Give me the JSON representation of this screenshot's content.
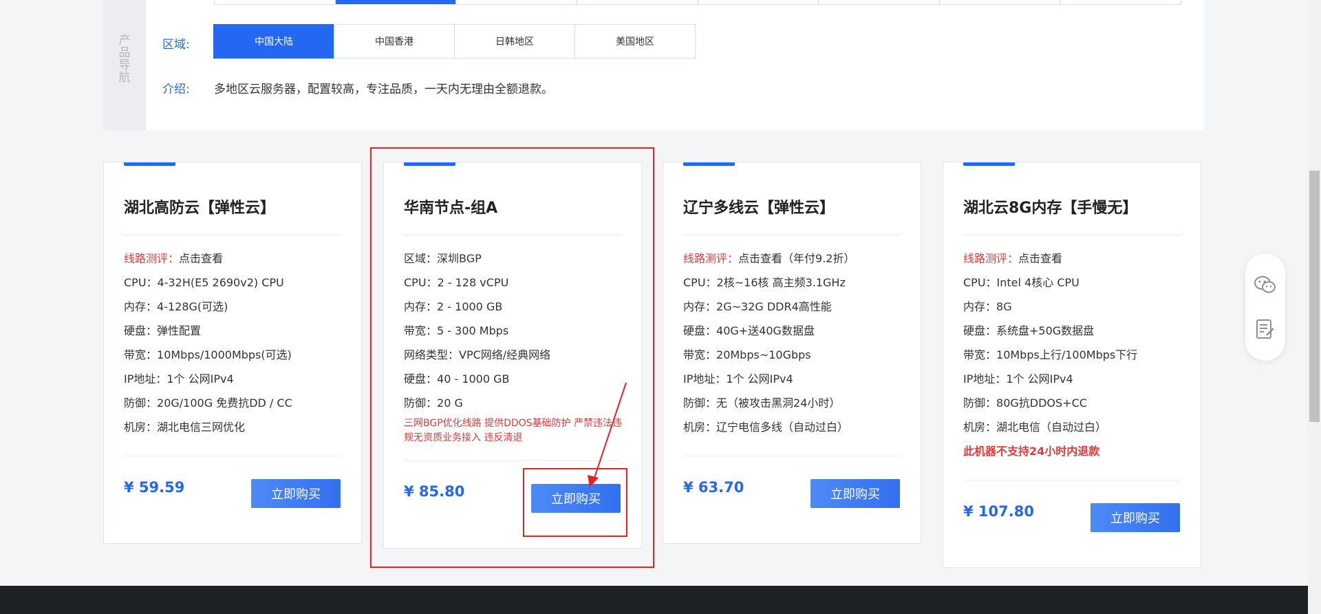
{
  "nav": {
    "side_label": "产品导航",
    "region_label": "区域:",
    "intro_label": "介绍:",
    "regions": [
      {
        "label": "中国大陆",
        "active": true
      },
      {
        "label": "中国香港",
        "active": false
      },
      {
        "label": "日韩地区",
        "active": false
      },
      {
        "label": "美国地区",
        "active": false
      }
    ],
    "intro_text": "多地区云服务器，配置较高，专注品质，一天内无理由全额退款。"
  },
  "cards": [
    {
      "title": "湖北高防云【弹性云】",
      "specs": [
        {
          "k": "线路测评：",
          "v": "点击查看",
          "red_key": true
        },
        {
          "k": "CPU：",
          "v": "4-32H(E5 2690v2) CPU"
        },
        {
          "k": "内存：",
          "v": "4-128G(可选)"
        },
        {
          "k": "硬盘：",
          "v": "弹性配置"
        },
        {
          "k": "带宽：",
          "v": "10Mbps/1000Mbps(可选)"
        },
        {
          "k": "IP地址：",
          "v": "1个 公网IPv4"
        },
        {
          "k": "防御：",
          "v": "20G/100G 免费抗DD / CC"
        },
        {
          "k": "机房：",
          "v": "湖北电信三网优化"
        }
      ],
      "price": "¥ 59.59",
      "buy_label": "立即购买"
    },
    {
      "title": "华南节点-组A",
      "specs": [
        {
          "k": "区域：",
          "v": "深圳BGP"
        },
        {
          "k": "CPU：",
          "v": "2 - 128 vCPU"
        },
        {
          "k": "内存：",
          "v": "2 - 1000 GB"
        },
        {
          "k": "带宽：",
          "v": "5 - 300 Mbps"
        },
        {
          "k": "网络类型：",
          "v": "VPC网络/经典网络"
        },
        {
          "k": "硬盘：",
          "v": "40 - 1000 GB"
        },
        {
          "k": "防御：",
          "v": "20 G"
        }
      ],
      "note": "三网BGP优化线路 提供DDOS基础防护 严禁违法违规无资质业务接入 违反清退",
      "price": "¥ 85.80",
      "buy_label": "立即购买"
    },
    {
      "title": "辽宁多线云【弹性云】",
      "specs": [
        {
          "k": "线路测评：",
          "v": "点击查看（年付9.2折）",
          "red_key": true
        },
        {
          "k": "CPU：",
          "v": "2核~16核 高主频3.1GHz"
        },
        {
          "k": "内存：",
          "v": "2G~32G DDR4高性能"
        },
        {
          "k": "硬盘：",
          "v": "40G+送40G数据盘"
        },
        {
          "k": "带宽：",
          "v": "20Mbps~10Gbps"
        },
        {
          "k": "IP地址：",
          "v": "1个 公网IPv4"
        },
        {
          "k": "防御：",
          "v": "无（被攻击黑洞24小时）"
        },
        {
          "k": "机房：",
          "v": "辽宁电信多线（自动过白）"
        }
      ],
      "price": "¥ 63.70",
      "buy_label": "立即购买"
    },
    {
      "title": "湖北云8G内存【手慢无】",
      "specs": [
        {
          "k": "线路测评：",
          "v": "点击查看",
          "red_key": true
        },
        {
          "k": "CPU：",
          "v": "Intel 4核心 CPU"
        },
        {
          "k": "内存：",
          "v": "8G"
        },
        {
          "k": "硬盘：",
          "v": "系统盘+50G数据盘"
        },
        {
          "k": "带宽：",
          "v": "10Mbps上行/100Mbps下行"
        },
        {
          "k": "IP地址：",
          "v": "1个 公网IPv4"
        },
        {
          "k": "防御：",
          "v": "80G抗DDOS+CC"
        },
        {
          "k": "机房：",
          "v": "湖北电信（自动过白）"
        }
      ],
      "warning": "此机器不支持24小时内退款",
      "price": "¥ 107.80",
      "buy_label": "立即购买"
    }
  ],
  "float_icons": [
    "wechat-icon",
    "feedback-icon"
  ],
  "colors": {
    "accent": "#2468f2",
    "annotation": "#e82020",
    "red_text": "#e6393a"
  }
}
